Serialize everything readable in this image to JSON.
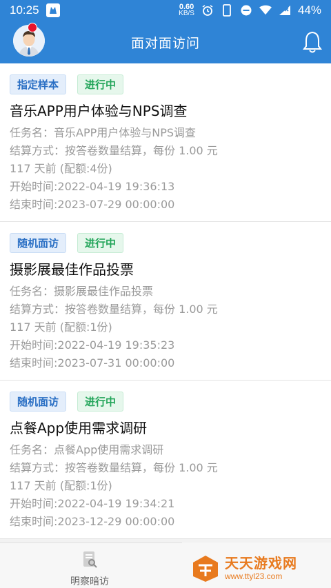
{
  "status_bar": {
    "time": "10:25",
    "net_speed_value": "0.60",
    "net_speed_unit": "KB/S",
    "battery": "44%"
  },
  "header": {
    "title": "面对面访问",
    "left_icon": "avatar",
    "right_icon": "bell-icon"
  },
  "tasks": [
    {
      "type_tag": "指定样本",
      "status_tag": "进行中",
      "title": "音乐APP用户体验与NPS调查",
      "task_name": "任务名：音乐APP用户体验与NPS调查",
      "settlement": "结算方式：按答卷数量结算，每份 1.00 元",
      "age_quota": "117 天前 (配额:4份)",
      "start_time": "开始时间:2022-04-19 19:36:13",
      "end_time": "结束时间:2023-07-29 00:00:00"
    },
    {
      "type_tag": "随机面访",
      "status_tag": "进行中",
      "title": "摄影展最佳作品投票",
      "task_name": "任务名：摄影展最佳作品投票",
      "settlement": "结算方式：按答卷数量结算，每份 1.00 元",
      "age_quota": "117 天前 (配额:1份)",
      "start_time": "开始时间:2022-04-19 19:35:23",
      "end_time": "结束时间:2023-07-31 00:00:00"
    },
    {
      "type_tag": "随机面访",
      "status_tag": "进行中",
      "title": "点餐App使用需求调研",
      "task_name": "任务名：点餐App使用需求调研",
      "settlement": "结算方式：按答卷数量结算，每份 1.00 元",
      "age_quota": "117 天前 (配额:1份)",
      "start_time": "开始时间:2022-04-19 19:34:21",
      "end_time": "结束时间:2023-12-29 00:00:00"
    }
  ],
  "bottom_tab": {
    "label": "明察暗访",
    "icon": "document-icon"
  },
  "watermark": {
    "name": "天天游戏网",
    "url": "www.ttyl23.com"
  },
  "colors": {
    "primary": "#2f84d6",
    "type_tag_text": "#2a6fc4",
    "status_tag_text": "#23a55a",
    "watermark": "#e87a1e"
  }
}
